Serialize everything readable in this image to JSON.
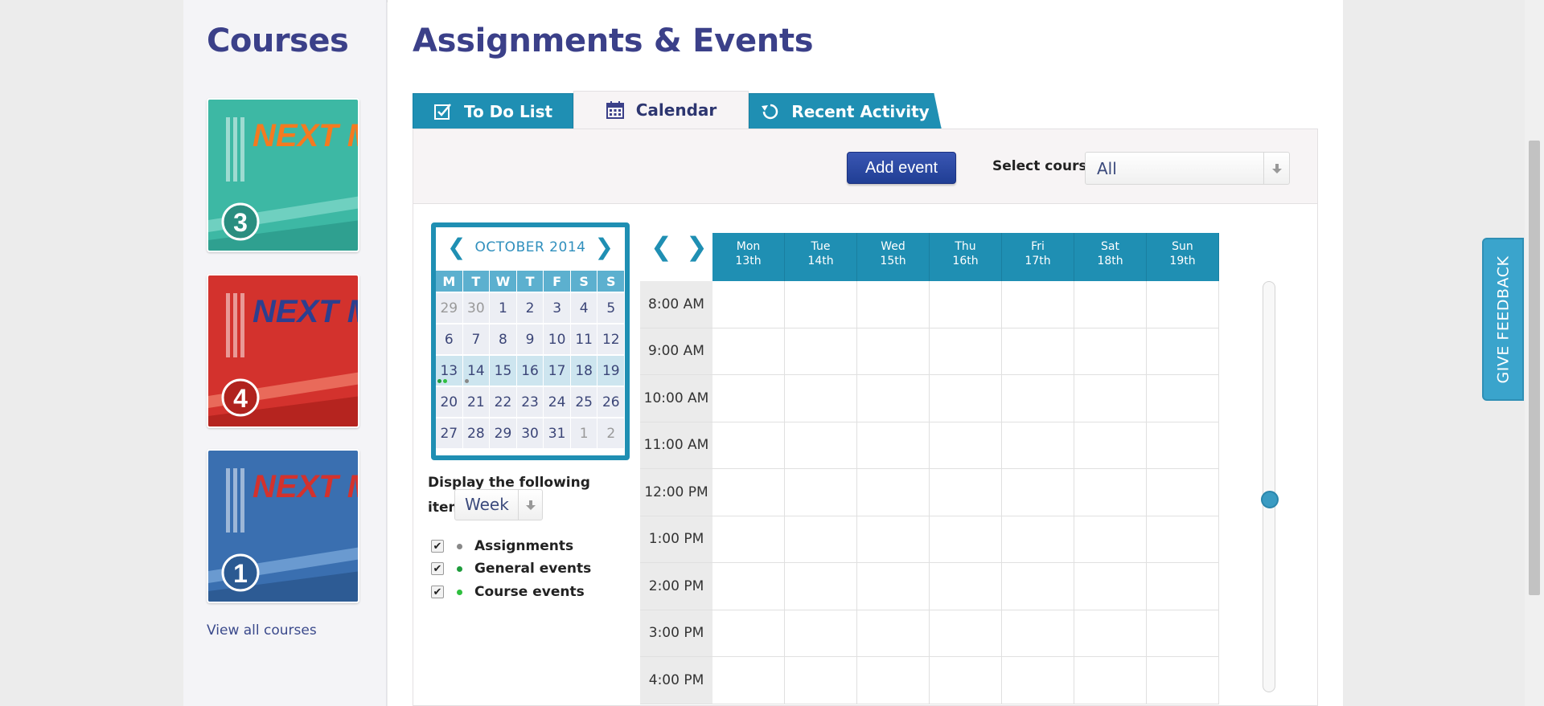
{
  "sidebar": {
    "title": "Courses",
    "courses": [
      {
        "name": "NEXT MOVE",
        "level": "3",
        "color": "#3db8a4"
      },
      {
        "name": "NEXT MOVE",
        "level": "4",
        "color": "#d3322d"
      },
      {
        "name": "NEXT MOVE",
        "level": "1",
        "color": "#3a6fb0"
      }
    ],
    "view_all": "View all courses"
  },
  "main": {
    "title": "Assignments & Events",
    "tabs": [
      {
        "label": "To Do List",
        "icon": "checkbox-icon"
      },
      {
        "label": "Calendar",
        "icon": "calendar-icon"
      },
      {
        "label": "Recent Activity",
        "icon": "refresh-icon"
      }
    ],
    "active_tab": "Calendar"
  },
  "toolbar": {
    "add_event": "Add event",
    "select_label": "Select course",
    "select_value": "All"
  },
  "minical": {
    "month": "OCTOBER 2014",
    "dow": [
      "M",
      "T",
      "W",
      "T",
      "F",
      "S",
      "S"
    ],
    "weeks": [
      [
        "29",
        "30",
        "1",
        "2",
        "3",
        "4",
        "5"
      ],
      [
        "6",
        "7",
        "8",
        "9",
        "10",
        "11",
        "12"
      ],
      [
        "13",
        "14",
        "15",
        "16",
        "17",
        "18",
        "19"
      ],
      [
        "20",
        "21",
        "22",
        "23",
        "24",
        "25",
        "26"
      ],
      [
        "27",
        "28",
        "29",
        "30",
        "31",
        "1",
        "2"
      ]
    ]
  },
  "display": {
    "text": "Display the following items for the",
    "period": "Week"
  },
  "filters": [
    {
      "label": "Assignments",
      "color": "#888888",
      "checked": true
    },
    {
      "label": "General events",
      "color": "#1e9c3c",
      "checked": true
    },
    {
      "label": "Course events",
      "color": "#2fbf3f",
      "checked": true
    }
  ],
  "week": {
    "days": [
      {
        "name": "Mon",
        "date": "13th"
      },
      {
        "name": "Tue",
        "date": "14th"
      },
      {
        "name": "Wed",
        "date": "15th"
      },
      {
        "name": "Thu",
        "date": "16th"
      },
      {
        "name": "Fri",
        "date": "17th"
      },
      {
        "name": "Sat",
        "date": "18th"
      },
      {
        "name": "Sun",
        "date": "19th"
      }
    ],
    "times": [
      "8:00 AM",
      "9:00 AM",
      "10:00 AM",
      "11:00 AM",
      "12:00 PM",
      "1:00 PM",
      "2:00 PM",
      "3:00 PM",
      "4:00 PM"
    ]
  },
  "feedback": "GIVE FEEDBACK",
  "colors": {
    "accent": "#1f8fb3",
    "brand": "#3b4089",
    "button": "#2a47a3"
  }
}
